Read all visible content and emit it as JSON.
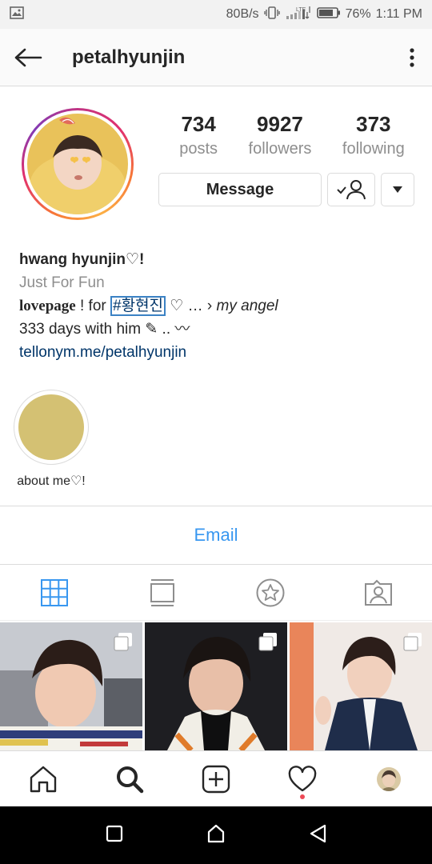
{
  "status_bar": {
    "speed": "80B/s",
    "network": "LTE",
    "battery": "76%",
    "time": "1:11 PM"
  },
  "header": {
    "username": "petalhyunjin"
  },
  "profile": {
    "stats": [
      {
        "value": "734",
        "label": "posts"
      },
      {
        "value": "9927",
        "label": "followers"
      },
      {
        "value": "373",
        "label": "following"
      }
    ],
    "message_label": "Message"
  },
  "bio": {
    "name": "hwang hyunjin♡!",
    "category": "Just For Fun",
    "line1_serif": "lovepage",
    "line1_mid": " ! for ",
    "line1_hashtag": "#황현진",
    "line1_after": " ♡ … › ",
    "line1_italic": "my angel",
    "line2": "333 days with him ✎ .. 〰",
    "link": "tellonym.me/petalhyunjin"
  },
  "highlights": [
    {
      "label": "about me♡!",
      "color": "#d4c173"
    }
  ],
  "email_label": "Email",
  "tabs": [
    "grid",
    "feed",
    "saved",
    "tagged"
  ],
  "colors": {
    "accent": "#3897f0",
    "link": "#003569",
    "secondary_text": "#8e8e8e",
    "notification": "#ed4956"
  }
}
